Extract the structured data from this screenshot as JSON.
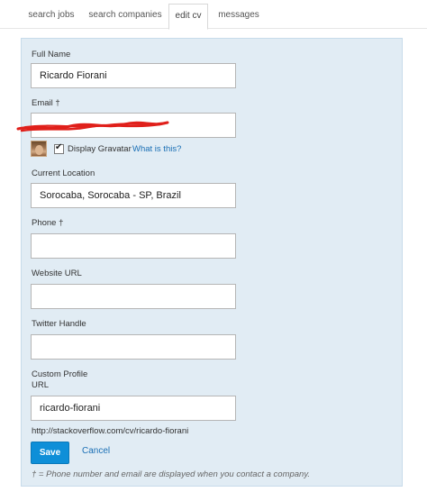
{
  "tabs": [
    {
      "label": "search jobs",
      "active": false
    },
    {
      "label": "search companies",
      "active": false
    },
    {
      "label": "edit cv",
      "active": true
    },
    {
      "label": "messages",
      "active": false
    }
  ],
  "form": {
    "full_name": {
      "label": "Full Name",
      "value": "Ricardo Fiorani"
    },
    "email": {
      "label": "Email †",
      "value": ""
    },
    "gravatar": {
      "label": "Display Gravatar",
      "checked": true,
      "link": "What is this?"
    },
    "location": {
      "label": "Current Location",
      "value": "Sorocaba, Sorocaba - SP, Brazil"
    },
    "phone": {
      "label": "Phone †",
      "value": ""
    },
    "website": {
      "label": "Website URL",
      "value": ""
    },
    "twitter": {
      "label": "Twitter Handle",
      "value": ""
    },
    "custom_url": {
      "label_line1": "Custom Profile",
      "label_line2": "URL",
      "value": "ricardo-fiorani"
    },
    "profile_url": "http://stackoverflow.com/cv/ricardo-fiorani",
    "save_label": "Save",
    "cancel_label": "Cancel",
    "footnote": "† = Phone number and email are displayed when you contact a company."
  },
  "colors": {
    "panel_bg": "#e1ecf4",
    "button": "#0e8fd8",
    "link": "#1a6fb5",
    "scribble": "#e0201b"
  }
}
